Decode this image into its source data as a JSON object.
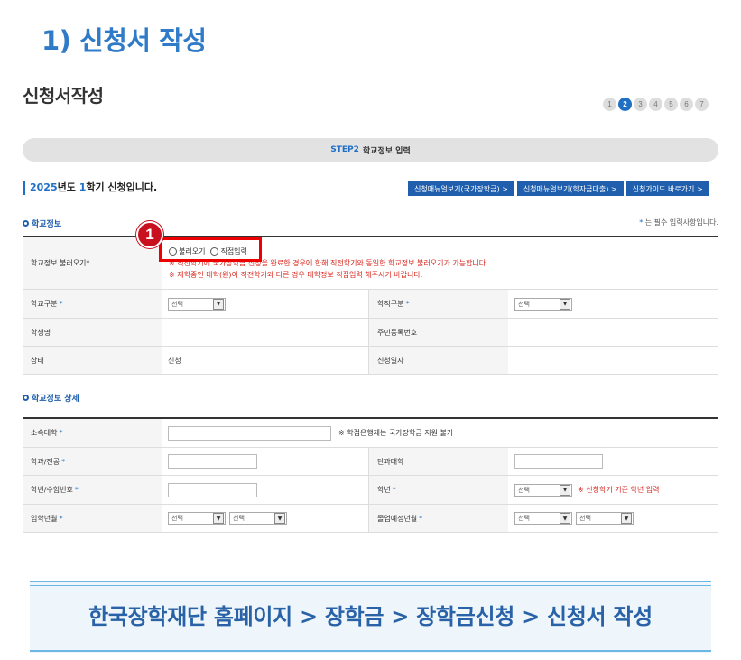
{
  "slide_title": "1) 신청서 작성",
  "form_title": "신청서작성",
  "steps": [
    "1",
    "2",
    "3",
    "4",
    "5",
    "6",
    "7"
  ],
  "active_step": 2,
  "step_bar": {
    "code": "STEP2",
    "label": "학교정보 입력"
  },
  "semester": {
    "year": "2025",
    "year_suffix": "년도 ",
    "term": "1",
    "term_suffix": "학기 신청입니다."
  },
  "menu_buttons": [
    "신청매뉴얼보기(국가장학금) >",
    "신청매뉴얼보기(학자금대출) >",
    "신청가이드 바로가기 >"
  ],
  "required_note": {
    "star": "*",
    "text": " 는 필수 입력사항입니다."
  },
  "section1": {
    "title": "학교정보",
    "load_label": "학교정보 불러오기*",
    "radio_load": "불러오기",
    "radio_direct": "직접입력",
    "warn1": "※ 직전학기에 국가장학금 신청을 완료한 경우에 한해 직전학기와 동일한 학교정보 불러오기가 가능합니다.",
    "warn2": "※ 재학중인 대학(원)이 직전학기와 다른 경우 대학정보 직접입력 해주시기 바랍니다.",
    "school_type_label": "학교구분",
    "school_record_label": "학적구분",
    "select_placeholder": "선택",
    "student_name_label": "학생명",
    "rrn_label": "주민등록번호",
    "status_label": "상태",
    "status_value": "신청",
    "apply_date_label": "신청일자",
    "required_star": "*"
  },
  "section2": {
    "title": "학교정보 상세",
    "univ_label": "소속대학",
    "univ_note": "※ 학점은행제는 국가장학금 지원 불가",
    "dept_label": "학과/전공",
    "college_label": "단과대학",
    "student_no_label": "학번/수험번호",
    "grade_label": "학년",
    "grade_note": "※ 신청학기 기준 학년 입력",
    "entry_label": "입학년월",
    "grad_label": "졸업예정년월",
    "select_placeholder": "선택",
    "required_star": "*"
  },
  "callout_number": "1",
  "caption": "한국장학재단 홈페이지 > 장학금 > 장학금신청 > 신청서 작성",
  "colors": {
    "brand_blue": "#1f6fc5",
    "warn_red": "#d9261c",
    "highlight_red": "#e00000",
    "caption_blue": "#2a62a8"
  }
}
